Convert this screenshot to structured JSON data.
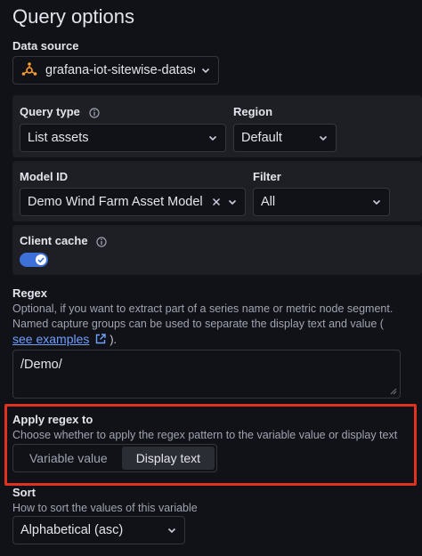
{
  "title": "Query options",
  "data_source": {
    "label": "Data source",
    "value": "grafana-iot-sitewise-datasource"
  },
  "query_type": {
    "label": "Query type",
    "value": "List assets"
  },
  "region": {
    "label": "Region",
    "value": "Default"
  },
  "model_id": {
    "label": "Model ID",
    "value": "Demo Wind Farm Asset Model"
  },
  "filter": {
    "label": "Filter",
    "value": "All"
  },
  "client_cache": {
    "label": "Client cache",
    "enabled": true
  },
  "regex": {
    "label": "Regex",
    "description": "Optional, if you want to extract part of a series name or metric node segment. Named capture groups can be used to separate the display text and value (",
    "link_text": "see examples",
    "after_link": ").",
    "value": "/Demo/"
  },
  "apply_regex": {
    "label": "Apply regex to",
    "description": "Choose whether to apply the regex pattern to the variable value or display text",
    "options": [
      "Variable value",
      "Display text"
    ],
    "selected": "Display text"
  },
  "sort": {
    "label": "Sort",
    "description": "How to sort the values of this variable",
    "value": "Alphabetical (asc)"
  },
  "colors": {
    "accent": "#3d71d9",
    "highlight": "#e0321f",
    "link": "#6e9fff"
  }
}
